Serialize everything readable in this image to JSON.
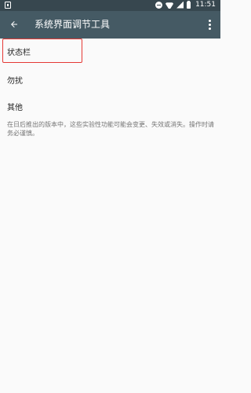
{
  "status_bar": {
    "time": "11:51",
    "icons": [
      "notification-icon",
      "do-not-disturb-icon",
      "wifi-icon",
      "signal-icon",
      "battery-icon"
    ]
  },
  "app_bar": {
    "title": "系统界面调节工具",
    "back_icon": "arrow-back-icon",
    "overflow_icon": "more-vert-icon",
    "color": "#455a64"
  },
  "list": {
    "items": [
      {
        "label": "状态栏",
        "highlighted": true
      },
      {
        "label": "勿扰",
        "highlighted": false
      },
      {
        "label": "其他",
        "highlighted": false
      }
    ]
  },
  "note": "在日后推出的版本中，这些实验性功能可能会变更、失效或消失。操作时请务必谨慎。",
  "colors": {
    "status_bar": "#37474f",
    "app_bar": "#455a64",
    "highlight_border": "#e53935",
    "background": "#fafafa"
  }
}
